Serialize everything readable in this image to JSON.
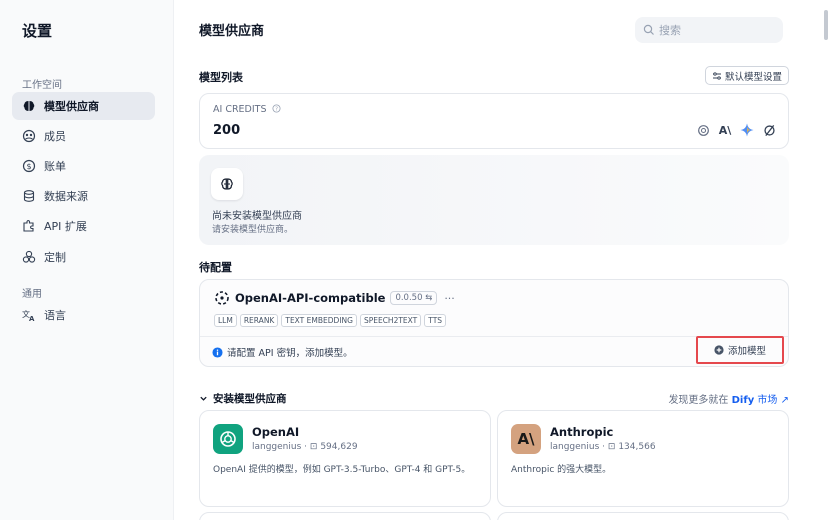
{
  "sidebar": {
    "title": "设置",
    "workspace_label": "工作空间",
    "general_label": "通用",
    "items": [
      {
        "label": "模型供应商"
      },
      {
        "label": "成员"
      },
      {
        "label": "账单"
      },
      {
        "label": "数据来源"
      },
      {
        "label": "API 扩展"
      },
      {
        "label": "定制"
      },
      {
        "label": "语言"
      }
    ]
  },
  "header": {
    "title": "模型供应商",
    "search_placeholder": "搜索"
  },
  "model_list": {
    "heading": "模型列表",
    "default_model_button": "默认模型设置"
  },
  "credits": {
    "label": "AI CREDITS",
    "value": "200",
    "logo_text_anthropic": "A\\"
  },
  "empty_state": {
    "title": "尚未安装模型供应商",
    "subtitle": "请安装模型供应商。"
  },
  "pending": {
    "heading": "待配置",
    "provider_name": "OpenAI-API-compatible",
    "version": "0.0.50",
    "more": "···",
    "tags": [
      "LLM",
      "RERANK",
      "TEXT EMBEDDING",
      "SPEECH2TEXT",
      "TTS"
    ],
    "warning": "请配置 API 密钥，添加模型。",
    "add_model_button": "添加模型"
  },
  "install": {
    "heading": "安装模型供应商",
    "market_prefix": "发现更多就在",
    "market_brand": "Dify",
    "market_suffix": "市场",
    "market_arrow": "↗",
    "providers": [
      {
        "name": "OpenAI",
        "author": "langgenius",
        "downloads": "594,629",
        "desc": "OpenAI 提供的模型，例如 GPT-3.5-Turbo、GPT-4 和 GPT-5。",
        "logo_color": "#10a37f"
      },
      {
        "name": "Anthropic",
        "author": "langgenius",
        "downloads": "134,566",
        "desc": "Anthropic 的强大模型。",
        "logo_color": "#d4a27f",
        "logo_text": "A\\"
      }
    ]
  },
  "colors": {
    "accent": "#155eef",
    "highlight": "#e5484d",
    "info": "#1570ef"
  }
}
